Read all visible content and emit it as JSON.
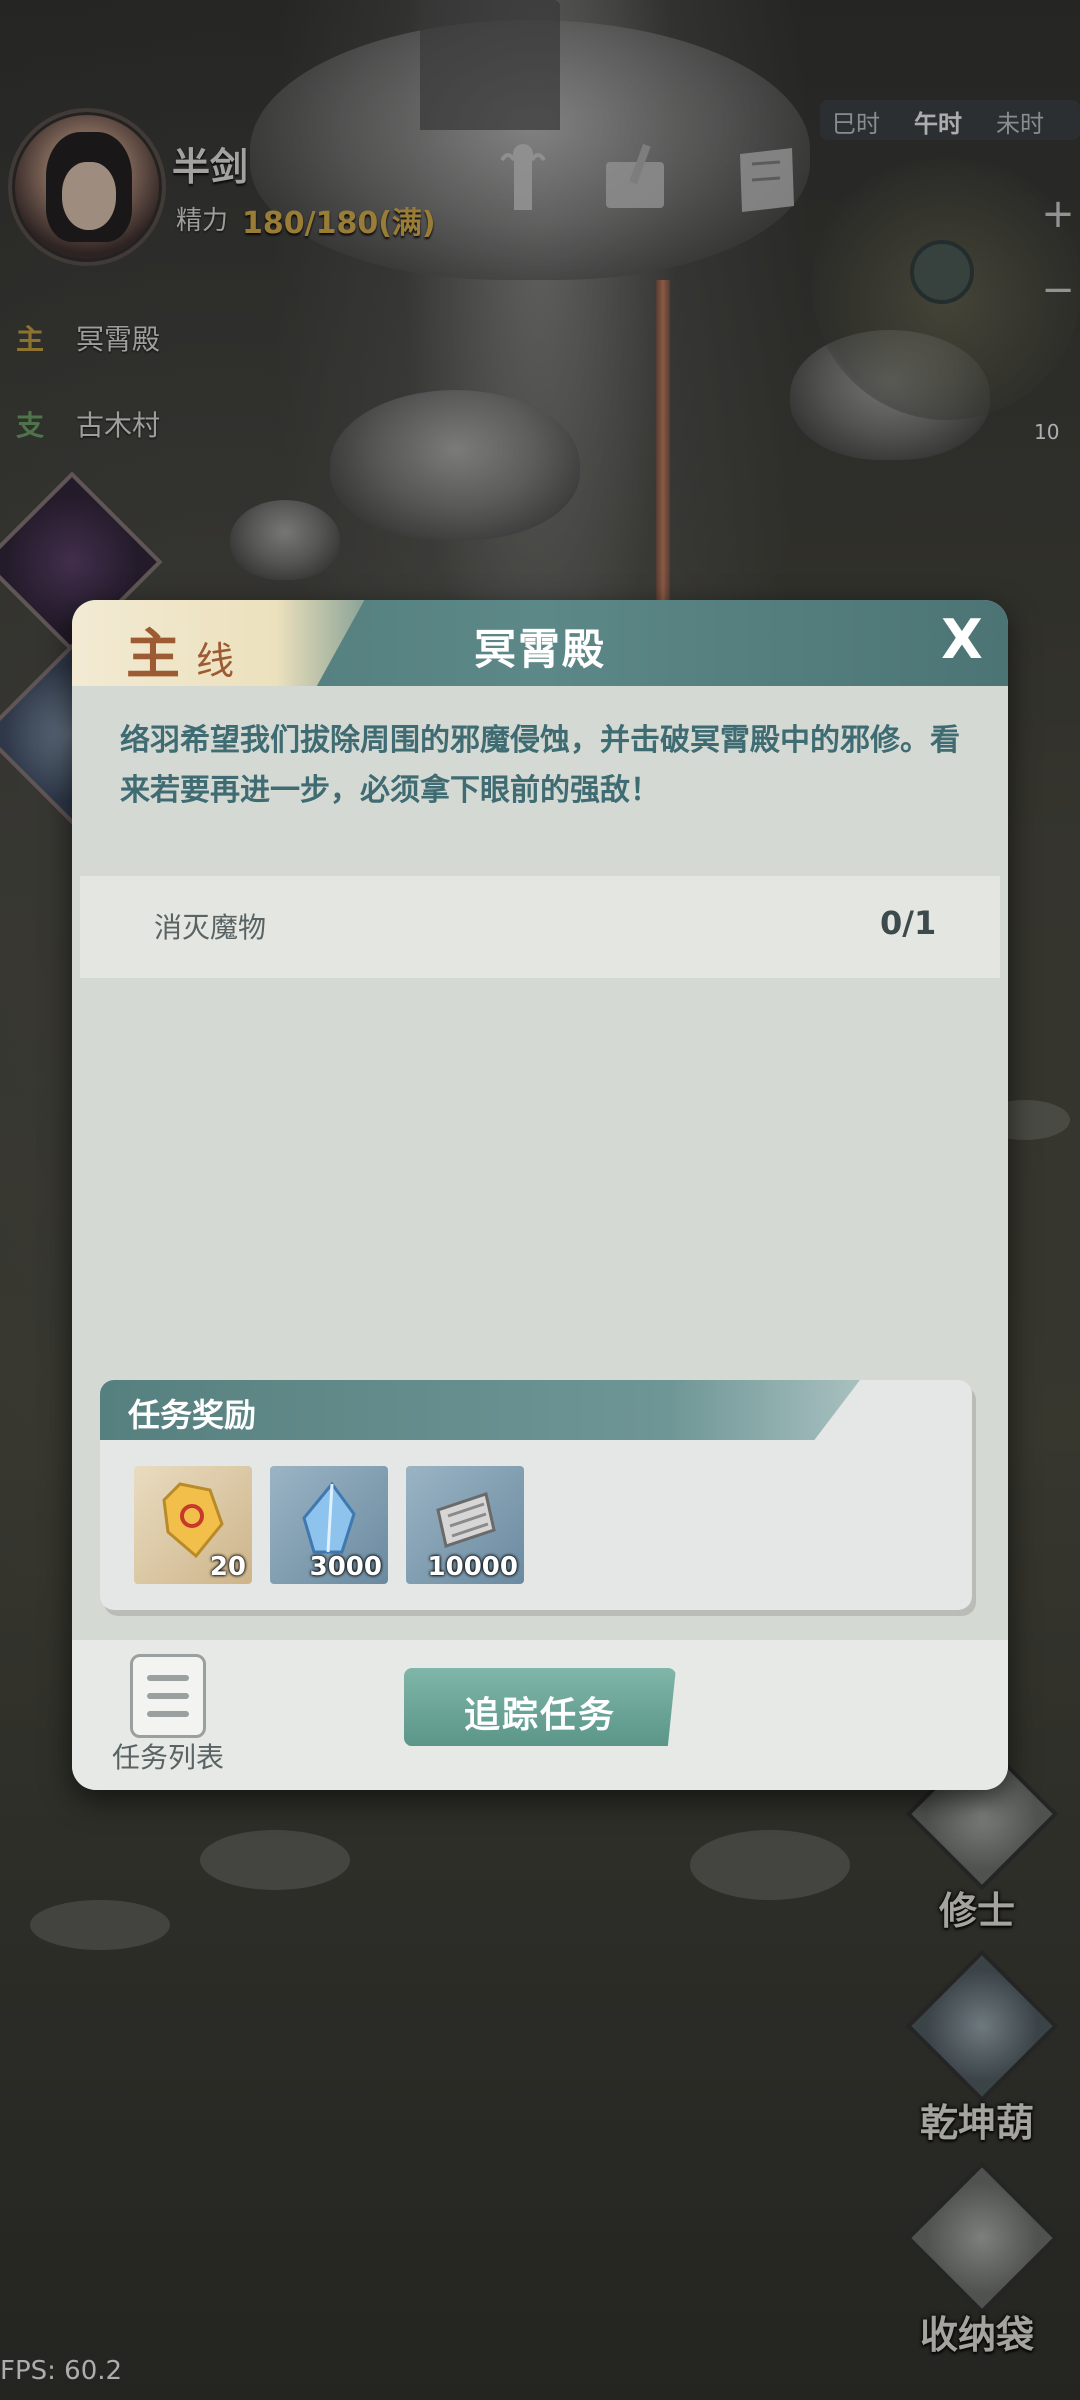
{
  "player": {
    "name": "半剑",
    "energy_label": "精力",
    "energy_value": "180/180(满)"
  },
  "quests": [
    {
      "tag": "主",
      "name": "冥霄殿",
      "tag_color": "#d0a640"
    },
    {
      "tag": "支",
      "name": "古木村",
      "tag_color": "#6fa86a"
    }
  ],
  "time_bar": {
    "items": [
      "巳时",
      "午时",
      "未时"
    ],
    "active": "午时"
  },
  "minimap": {
    "zoom_in": "+",
    "zoom_out": "−",
    "badge": "10"
  },
  "dialog": {
    "tab_main": "主",
    "tab_sub": "线",
    "title": "冥霄殿",
    "close": "X",
    "description": "络羽希望我们拔除周围的邪魔侵蚀，并击破冥霄殿中的邪修。看来若要再进一步，必须拿下眼前的强敌！",
    "objective": {
      "label": "消灭魔物",
      "count": "0/1"
    },
    "reward_title": "任务奖励",
    "rewards": [
      {
        "icon": "gold-crystal-icon",
        "qty": "20",
        "style": "gold"
      },
      {
        "icon": "blue-crystal-icon",
        "qty": "3000",
        "style": "blue"
      },
      {
        "icon": "scroll-icon",
        "qty": "10000",
        "style": "blue"
      }
    ],
    "list_label": "任务列表",
    "track_label": "追踪任务"
  },
  "right_menu": [
    {
      "label": "修士"
    },
    {
      "label": "乾坤葫"
    },
    {
      "label": "收纳袋"
    }
  ],
  "fps": "FPS: 60.2",
  "colors": {
    "accent_teal": "#5d8888",
    "tab_brown": "#9c5b32",
    "energy_gold": "#e0b64b",
    "track_button": "#6fa89a"
  }
}
